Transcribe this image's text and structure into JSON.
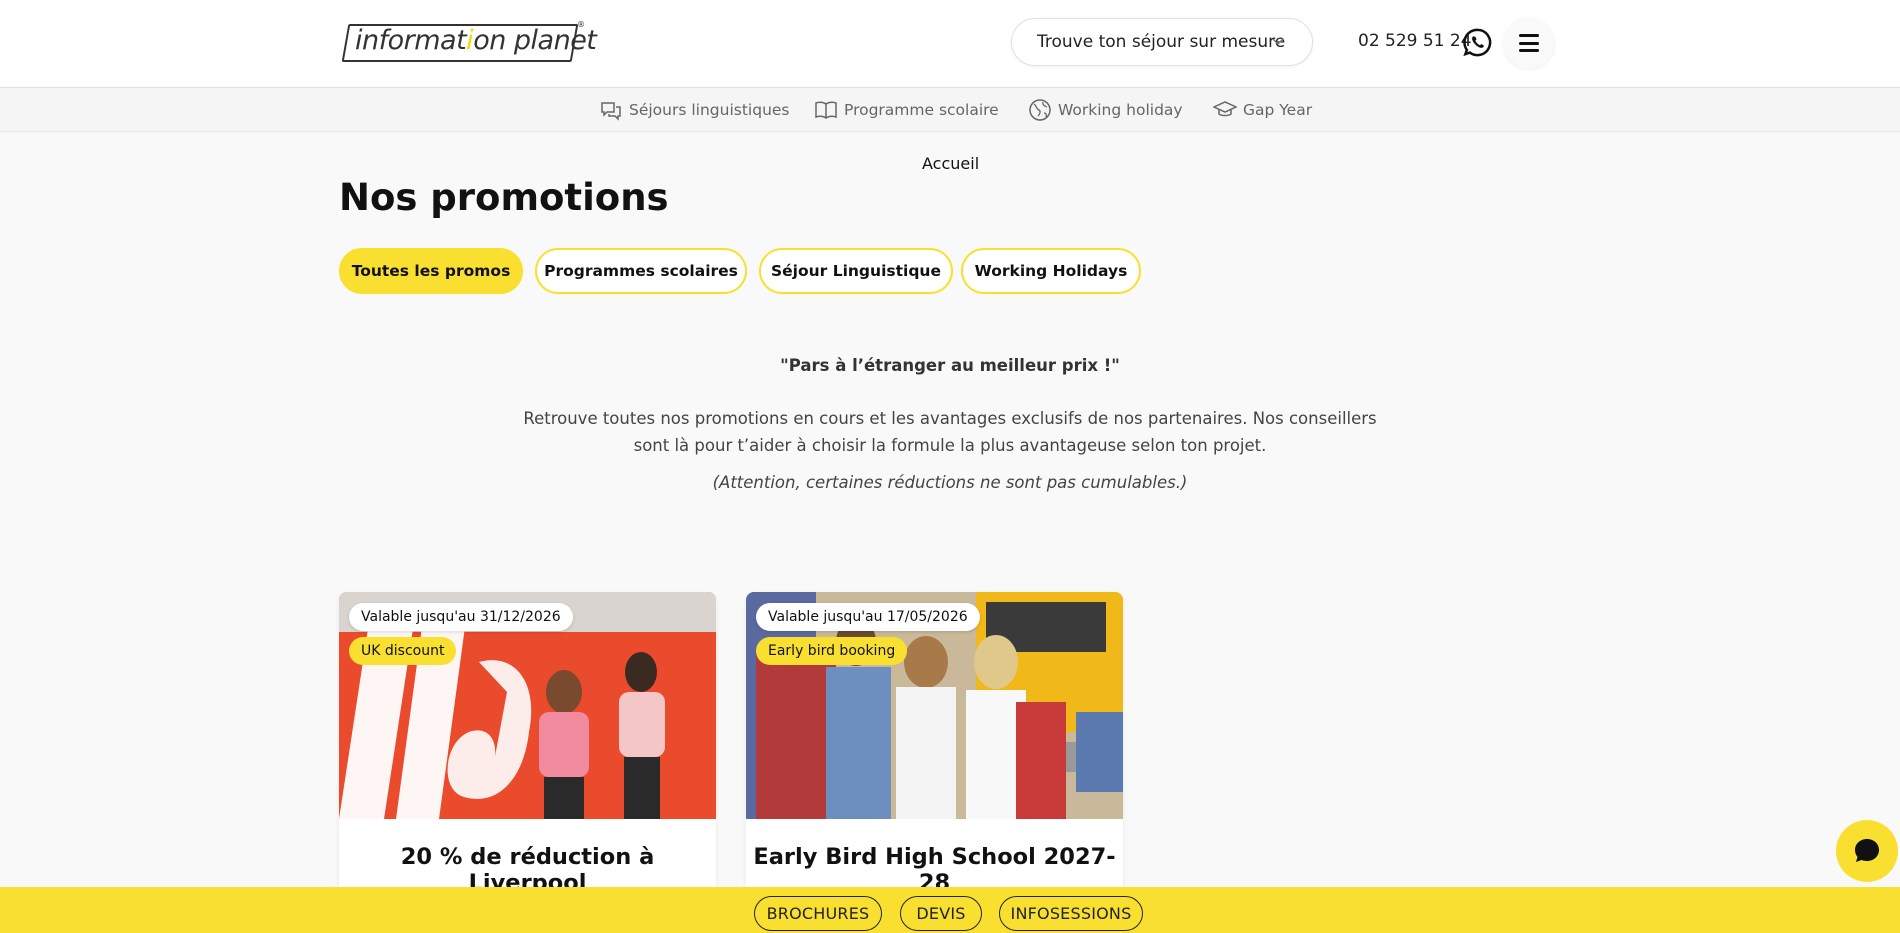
{
  "header": {
    "logo": {
      "prefix": "informat",
      "accent": "i",
      "suffix": "on planet",
      "reg": "®"
    },
    "dropdown_label": "Trouve ton séjour sur mesure",
    "phone": "02 529 51 24"
  },
  "subnav": [
    {
      "label": "Séjours linguistiques",
      "icon": "chat-bubbles-icon"
    },
    {
      "label": "Programme scolaire",
      "icon": "open-book-icon"
    },
    {
      "label": "Working holiday",
      "icon": "globe-icon"
    },
    {
      "label": "Gap Year",
      "icon": "graduation-cap-icon"
    }
  ],
  "breadcrumb": "Accueil",
  "page_title": "Nos promotions",
  "tabs": [
    {
      "label": "Toutes les promos",
      "active": true
    },
    {
      "label": "Programmes scolaires",
      "active": false
    },
    {
      "label": "Séjour Linguistique",
      "active": false
    },
    {
      "label": "Working Holidays",
      "active": false
    }
  ],
  "tagline": "\"Pars à l’étranger au meilleur prix !\"",
  "intro": "Retrouve toutes nos promotions en cours et les avantages exclusifs de nos partenaires. Nos conseillers sont là pour t’aider à choisir la formule la plus avantageuse selon ton projet.",
  "note": "(Attention, certaines réductions ne sont pas cumulables.)",
  "cards": [
    {
      "valid": "Valable jusqu'au 31/12/2026",
      "tag": "UK discount",
      "title": "20 % de réduction à Liverpool"
    },
    {
      "valid": "Valable jusqu'au 17/05/2026",
      "tag": "Early bird booking",
      "title": "Early Bird High School 2027-28"
    }
  ],
  "bottom_bar": [
    "BROCHURES",
    "DEVIS",
    "INFOSESSIONS"
  ],
  "colors": {
    "brand_yellow": "#f9e030"
  }
}
